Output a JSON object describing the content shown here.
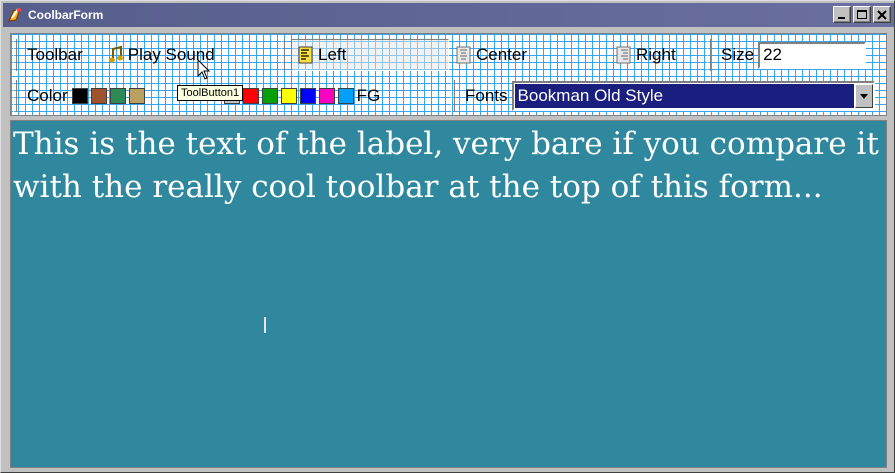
{
  "window": {
    "title": "CoolbarForm"
  },
  "toolbar": {
    "label": "Toolbar",
    "play_sound": "Play Sound",
    "left": "Left",
    "center": "Center",
    "right": "Right",
    "size_label": "Size",
    "size_value": "22",
    "tooltip": "ToolButton1"
  },
  "color_bar": {
    "label": "Color",
    "fg_label": "FG",
    "bg_swatches": [
      "#000000",
      "#a0522d",
      "#2e8b57",
      "#b8a060"
    ],
    "fg_swatches": [
      "#c0c0c0",
      "#ff0000",
      "#00a000",
      "#ffff00",
      "#0000ff",
      "#ff00c0",
      "#00a0ff"
    ]
  },
  "fonts": {
    "label": "Fonts",
    "value": "Bookman Old Style"
  },
  "content": {
    "label_text": "This is the text of the label, very bare if you compare it with the really cool toolbar at the top of this form..."
  }
}
